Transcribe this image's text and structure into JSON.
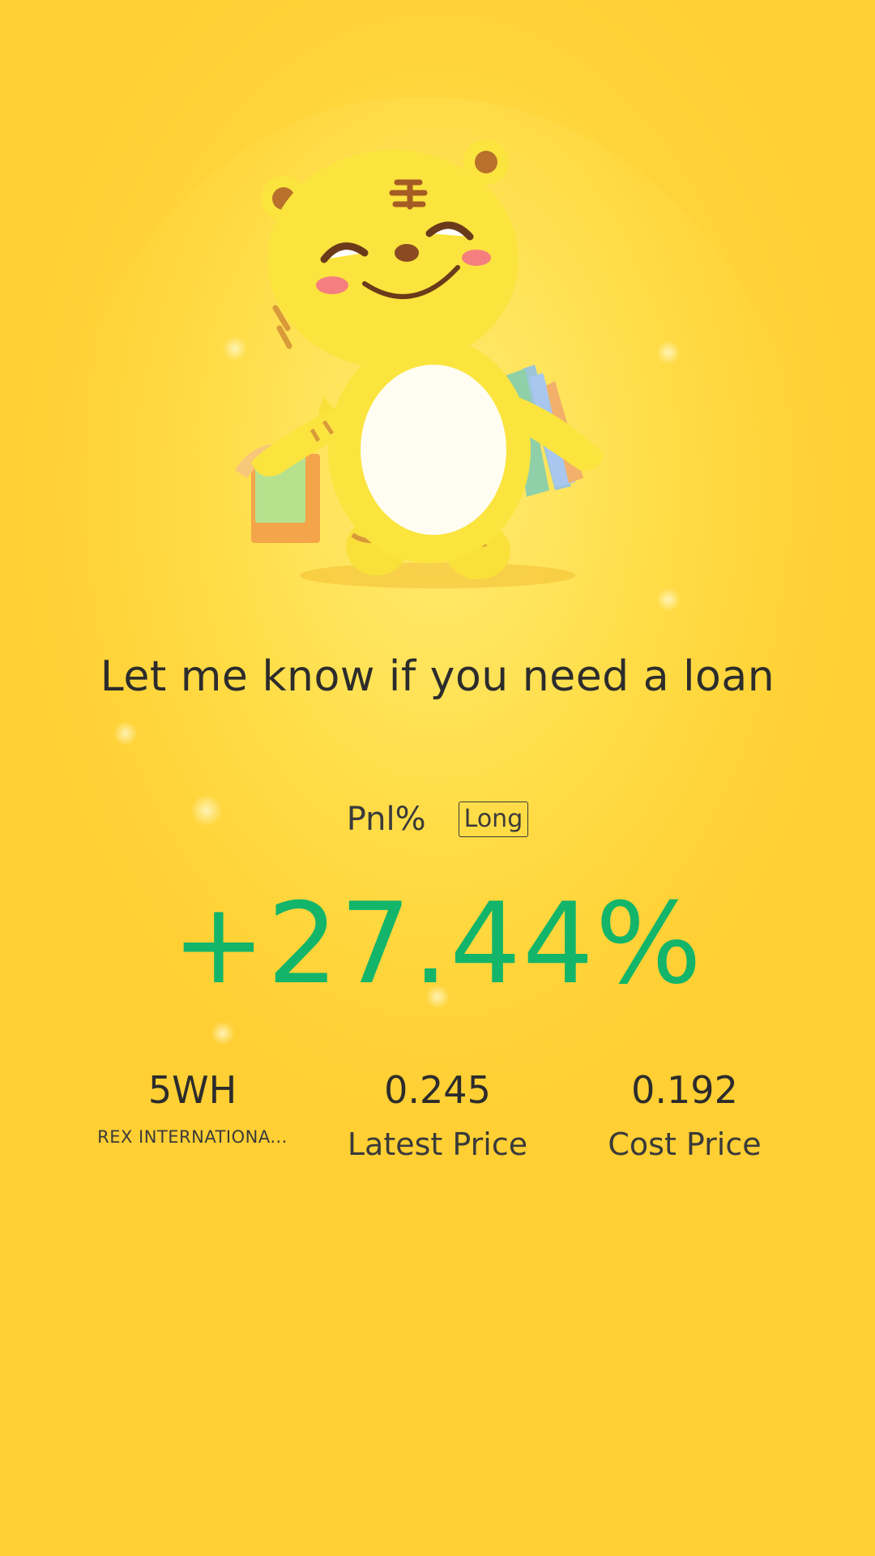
{
  "header": {
    "title": "Let me know if you need a loan"
  },
  "pnl": {
    "label": "Pnl%",
    "position_type": "Long",
    "value": "+27.44%",
    "value_color": "#12b569"
  },
  "stats": {
    "symbol": "5WH",
    "company": "REX INTERNATIONA...",
    "latest_price": "0.245",
    "latest_price_label": "Latest Price",
    "cost_price": "0.192",
    "cost_price_label": "Cost Price"
  },
  "mascot": {
    "icon": "tiger-mascot-with-shopping-bags-icon"
  },
  "colors": {
    "background": "#ffd43a",
    "text": "#2c2c2c",
    "gain": "#12b569"
  }
}
